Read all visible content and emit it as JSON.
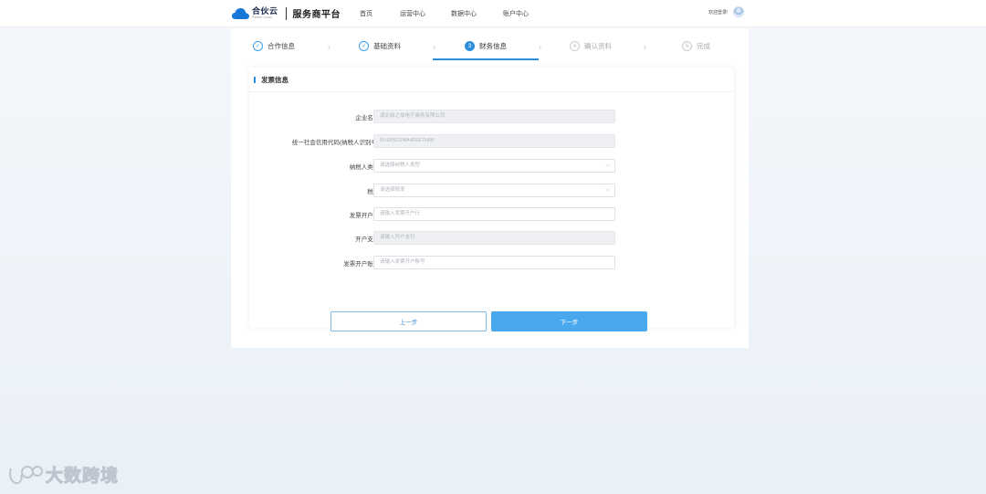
{
  "header": {
    "logo_name": "合伙云",
    "logo_sub": "Partner Cloud",
    "platform_title": "服务商平台",
    "nav": [
      "首页",
      "运营中心",
      "数据中心",
      "账户中心"
    ],
    "welcome": "欢迎登录!"
  },
  "steps": [
    {
      "label": "合作信息",
      "marker": "✓",
      "state": "done"
    },
    {
      "label": "基础资料",
      "marker": "✓",
      "state": "done"
    },
    {
      "label": "财务信息",
      "marker": "3",
      "state": "active"
    },
    {
      "label": "确认资料",
      "marker": "4",
      "state": "todo"
    },
    {
      "label": "完成",
      "marker": "5",
      "state": "todo"
    }
  ],
  "section_title": "发票信息",
  "form": {
    "company_name": {
      "label": "企业名称:",
      "value": "湖北纬之伯电子商务有限公司"
    },
    "tax_id": {
      "label": "统一社会信用代码(纳税人识别号):",
      "value": "91420921MA4F5E7H68"
    },
    "taxpayer_type": {
      "label": "纳税人类型:",
      "placeholder": "请选择纳税人类型"
    },
    "tax_rate": {
      "label": "税率:",
      "placeholder": "请选择税率"
    },
    "invoice_bank": {
      "label": "发票开户行:",
      "placeholder": "请输入发票开户行"
    },
    "branch_bank": {
      "label": "开户支行:",
      "placeholder": "请输入开户支行"
    },
    "invoice_account": {
      "label": "发票开户账号:",
      "placeholder": "请输入发票开户账号"
    }
  },
  "buttons": {
    "prev": "上一步",
    "next": "下一步"
  },
  "watermark": "大数跨境",
  "colors": {
    "accent": "#2d8fdc",
    "next_button": "#4aa8ee"
  }
}
